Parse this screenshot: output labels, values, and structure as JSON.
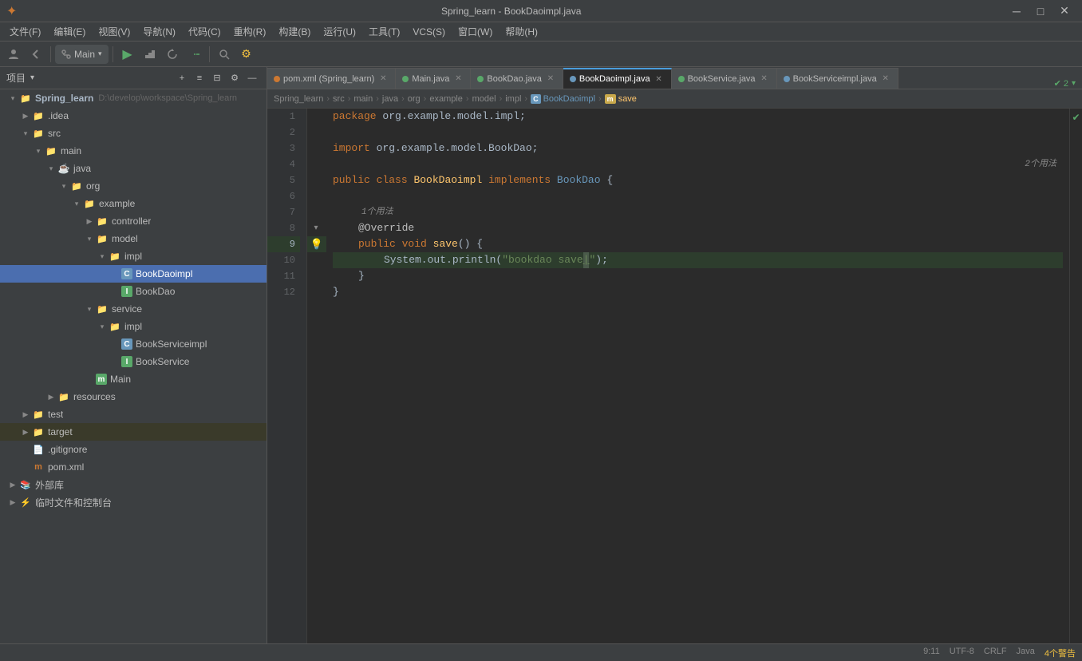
{
  "titlebar": {
    "title": "Spring_learn - BookDaoimpl.java",
    "logo": "✦",
    "btn_min": "─",
    "btn_max": "□",
    "btn_close": "✕"
  },
  "menubar": {
    "items": [
      "文件(F)",
      "编辑(E)",
      "视图(V)",
      "导航(N)",
      "代码(C)",
      "重构(R)",
      "构建(B)",
      "运行(U)",
      "工具(T)",
      "VCS(S)",
      "窗口(W)",
      "帮助(H)"
    ]
  },
  "toolbar": {
    "branch": "Main",
    "breadcrumb": {
      "parts": [
        "Spring_learn",
        "src",
        "main",
        "java",
        "org",
        "example",
        "model",
        "impl",
        "BookDaoimpl",
        "save"
      ]
    }
  },
  "project_panel": {
    "title": "项目",
    "dropdown_arrow": "▾"
  },
  "tree": {
    "items": [
      {
        "id": "spring_learn",
        "label": "Spring_learn",
        "extra": "D:\\develop\\workspace\\Spring_learn",
        "indent": 0,
        "arrow": "▾",
        "icon": "folder",
        "icon_color": "blue",
        "selected": false
      },
      {
        "id": "idea",
        "label": ".idea",
        "indent": 1,
        "arrow": "▶",
        "icon": "folder",
        "icon_color": "normal",
        "selected": false
      },
      {
        "id": "src",
        "label": "src",
        "indent": 1,
        "arrow": "▾",
        "icon": "folder",
        "icon_color": "normal",
        "selected": false
      },
      {
        "id": "main",
        "label": "main",
        "indent": 2,
        "arrow": "▾",
        "icon": "folder",
        "icon_color": "normal",
        "selected": false
      },
      {
        "id": "java",
        "label": "java",
        "indent": 3,
        "arrow": "▾",
        "icon": "folder-java",
        "icon_color": "blue",
        "selected": false
      },
      {
        "id": "org",
        "label": "org",
        "indent": 4,
        "arrow": "▾",
        "icon": "folder",
        "icon_color": "normal",
        "selected": false
      },
      {
        "id": "example",
        "label": "example",
        "indent": 5,
        "arrow": "▾",
        "icon": "folder",
        "icon_color": "normal",
        "selected": false
      },
      {
        "id": "controller",
        "label": "controller",
        "indent": 6,
        "arrow": "▶",
        "icon": "folder",
        "icon_color": "normal",
        "selected": false
      },
      {
        "id": "model",
        "label": "model",
        "indent": 6,
        "arrow": "▾",
        "icon": "folder",
        "icon_color": "normal",
        "selected": false
      },
      {
        "id": "impl",
        "label": "impl",
        "indent": 7,
        "arrow": "▾",
        "icon": "folder",
        "icon_color": "normal",
        "selected": false
      },
      {
        "id": "BookDaoimpl",
        "label": "BookDaoimpl",
        "indent": 8,
        "arrow": "",
        "icon": "class-c",
        "icon_color": "cyan",
        "selected": true
      },
      {
        "id": "BookDao",
        "label": "BookDao",
        "indent": 8,
        "arrow": "",
        "icon": "iface-i",
        "icon_color": "green",
        "selected": false
      },
      {
        "id": "service",
        "label": "service",
        "indent": 6,
        "arrow": "▾",
        "icon": "folder",
        "icon_color": "normal",
        "selected": false
      },
      {
        "id": "impl2",
        "label": "impl",
        "indent": 7,
        "arrow": "▾",
        "icon": "folder",
        "icon_color": "normal",
        "selected": false
      },
      {
        "id": "BookServiceimpl",
        "label": "BookServiceimpl",
        "indent": 8,
        "arrow": "",
        "icon": "class-c",
        "icon_color": "cyan",
        "selected": false
      },
      {
        "id": "BookService",
        "label": "BookService",
        "indent": 8,
        "arrow": "",
        "icon": "iface-i",
        "icon_color": "green",
        "selected": false
      },
      {
        "id": "Main",
        "label": "Main",
        "indent": 6,
        "arrow": "",
        "icon": "main-m",
        "icon_color": "green",
        "selected": false
      },
      {
        "id": "resources",
        "label": "resources",
        "indent": 3,
        "arrow": "▶",
        "icon": "folder",
        "icon_color": "normal",
        "selected": false
      },
      {
        "id": "test",
        "label": "test",
        "indent": 1,
        "arrow": "▶",
        "icon": "folder",
        "icon_color": "normal",
        "selected": false
      },
      {
        "id": "target",
        "label": "target",
        "indent": 1,
        "arrow": "▶",
        "icon": "folder",
        "icon_color": "yellow",
        "selected": false,
        "highlighted": true
      },
      {
        "id": "gitignore",
        "label": ".gitignore",
        "indent": 1,
        "arrow": "",
        "icon": "gitignore",
        "icon_color": "normal",
        "selected": false
      },
      {
        "id": "pom",
        "label": "pom.xml",
        "indent": 1,
        "arrow": "",
        "icon": "pom-m",
        "icon_color": "orange",
        "selected": false
      },
      {
        "id": "external-libs",
        "label": "外部库",
        "indent": 0,
        "arrow": "▶",
        "icon": "folder",
        "icon_color": "normal",
        "selected": false
      },
      {
        "id": "temp-files",
        "label": "临时文件和控制台",
        "indent": 0,
        "arrow": "▶",
        "icon": "console",
        "icon_color": "green",
        "selected": false
      }
    ]
  },
  "tabs": [
    {
      "id": "pom",
      "label": "pom.xml (Spring_learn)",
      "active": false,
      "dot_color": "#cc7832"
    },
    {
      "id": "main",
      "label": "Main.java",
      "active": false,
      "dot_color": "#59a869"
    },
    {
      "id": "bookdao",
      "label": "BookDao.java",
      "active": false,
      "dot_color": "#59a869"
    },
    {
      "id": "bookdaoimpl",
      "label": "BookDaoimpl.java",
      "active": true,
      "dot_color": "#6897bb"
    },
    {
      "id": "bookservice",
      "label": "BookService.java",
      "active": false,
      "dot_color": "#59a869"
    },
    {
      "id": "bookserviceimpl",
      "label": "BookServiceimpl.java",
      "active": false,
      "dot_color": "#6897bb"
    }
  ],
  "breadcrumb": {
    "parts": [
      "Spring_learn",
      "src",
      "main",
      "java",
      "org",
      "example",
      "model",
      "impl",
      "BookDaoimpl",
      "save"
    ]
  },
  "editor": {
    "lines": [
      {
        "num": 1,
        "code": "package org.example.model.impl;",
        "type": "plain"
      },
      {
        "num": 2,
        "code": "",
        "type": "empty"
      },
      {
        "num": 3,
        "code": "import org.example.model.BookDao;",
        "type": "plain"
      },
      {
        "num": 4,
        "code": "",
        "type": "empty"
      },
      {
        "num": 5,
        "code": "public class BookDaoimpl implements BookDao {",
        "type": "class"
      },
      {
        "num": 6,
        "code": "",
        "type": "empty"
      },
      {
        "num": 7,
        "code": "    @Override",
        "type": "annotation"
      },
      {
        "num": 8,
        "code": "    public void save() {",
        "type": "method"
      },
      {
        "num": 9,
        "code": "        System.out.println(\"bookdao save\");",
        "type": "print",
        "highlighted": true
      },
      {
        "num": 10,
        "code": "    }",
        "type": "plain"
      },
      {
        "num": 11,
        "code": "}",
        "type": "plain"
      },
      {
        "num": 12,
        "code": "",
        "type": "empty"
      }
    ],
    "hints": {
      "line4_5": "2个用法",
      "line6_7": "1个用法"
    }
  },
  "statusbar": {
    "left": "  ",
    "right_items": [
      "9:11",
      "UTF-8",
      "CRLF",
      "Java",
      "4个警告"
    ]
  },
  "gutter_icons": {
    "line8_run": "▶",
    "line8_fold": "▼",
    "line9_bulb": "💡"
  }
}
